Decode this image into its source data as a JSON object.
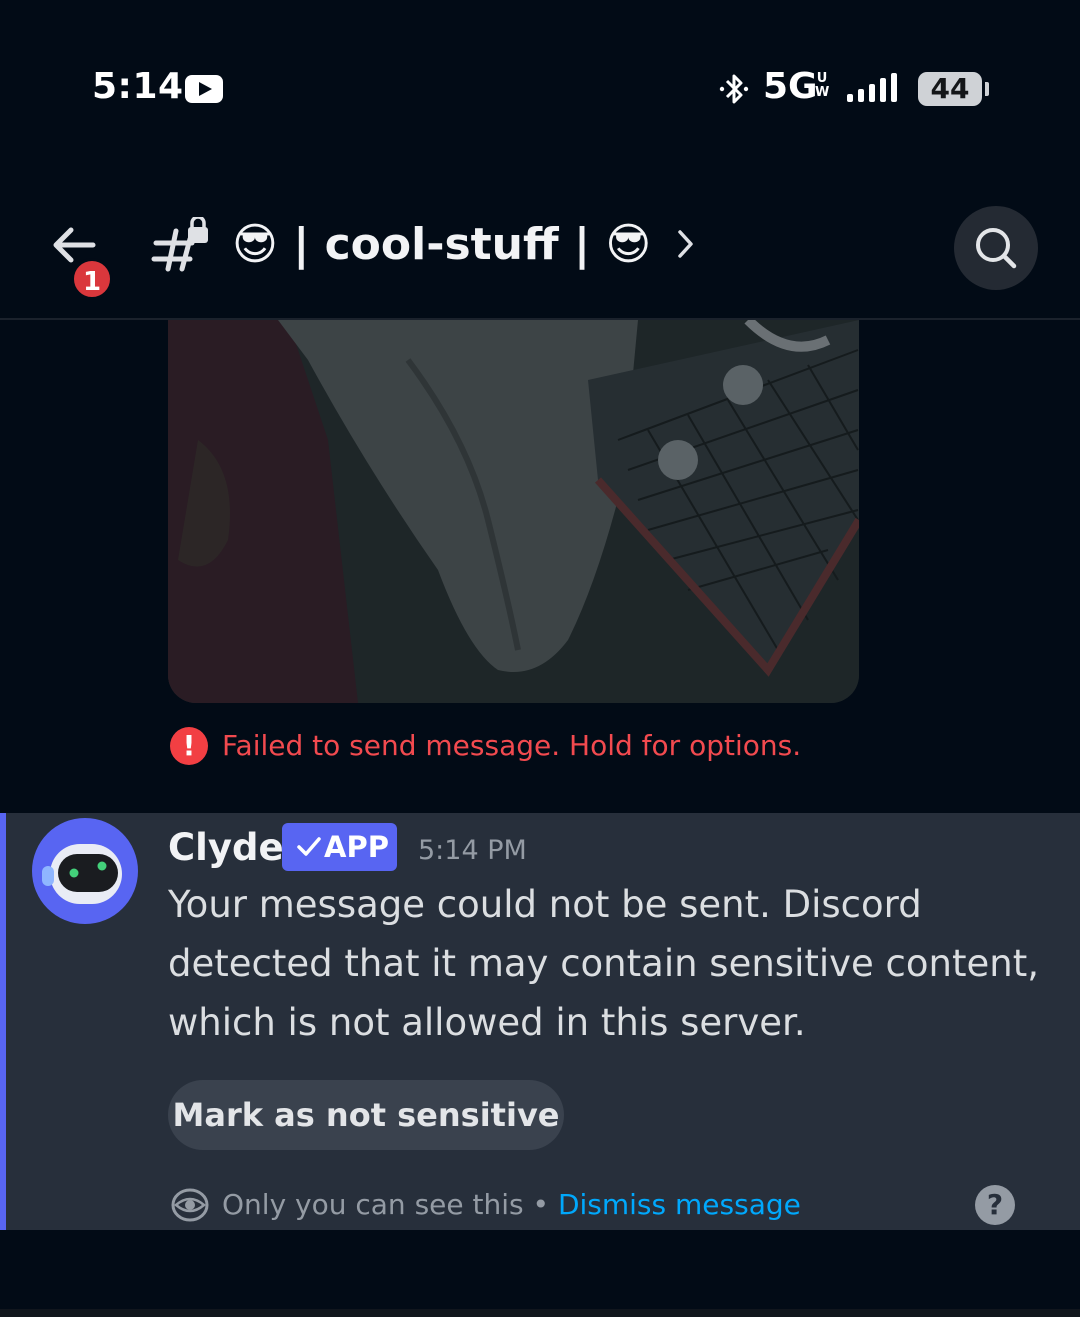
{
  "status_bar": {
    "time": "5:14",
    "network": "5G",
    "network_sub_top": "U",
    "network_sub_bottom": "W",
    "battery": "44"
  },
  "header": {
    "back_badge_count": "1",
    "channel_title": "😎 | cool-stuff | 😎"
  },
  "attachment": {
    "error_text": "Failed to send message. Hold for options.",
    "error_icon": "!"
  },
  "clyde": {
    "name": "Clyde",
    "badge": "APP",
    "timestamp": "5:14 PM",
    "body": "Your message could not be sent. Discord detected that it may contain sensitive content, which is not allowed in this server.",
    "button_label": "Mark as not sensitive",
    "only_you_text": "Only you can see this",
    "separator": " • ",
    "dismiss_label": "Dismiss message",
    "help_icon": "?"
  },
  "colors": {
    "background": "#020b16",
    "accent": "#5865f2",
    "error": "#f24a4f",
    "link": "#00a8fc"
  }
}
